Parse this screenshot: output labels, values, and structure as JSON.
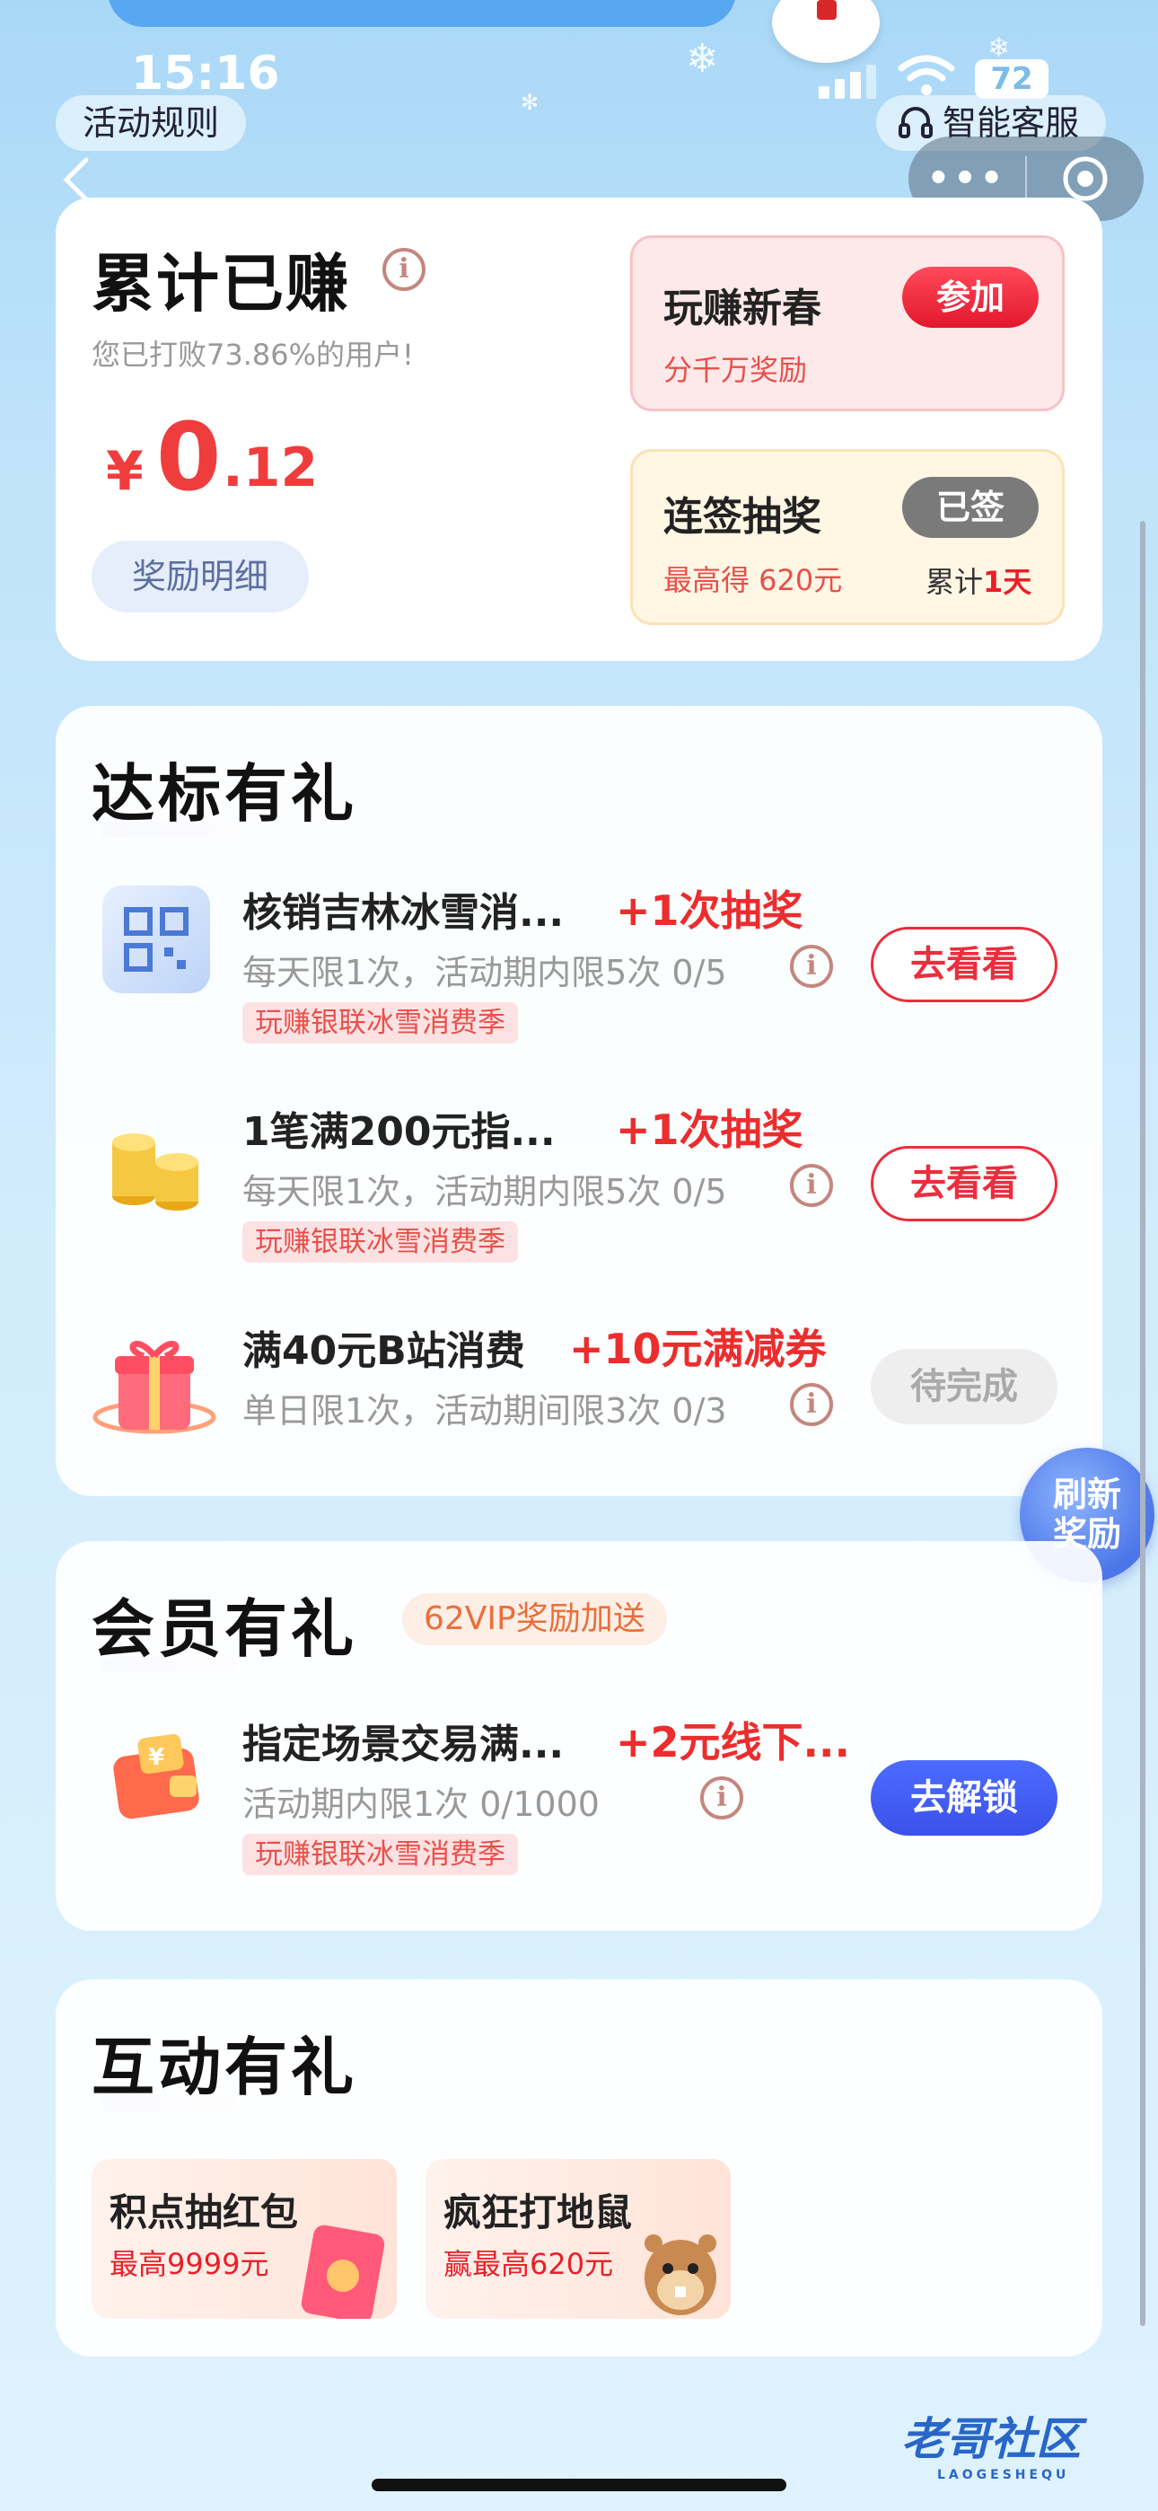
{
  "status_bar": {
    "time": "15:16",
    "battery": "72"
  },
  "header": {
    "rules_label": "活动规则",
    "service_label": "智能客服",
    "capsule_more": "•••"
  },
  "earnings": {
    "title": "累计已赚",
    "subtitle": "您已打败73.86%的用户!",
    "currency": "¥",
    "amount_integer": "0",
    "amount_decimal": ".12",
    "detail_button": "奖励明细",
    "promo_new_year": {
      "title": "玩赚新春",
      "subtitle": "分千万奖励",
      "button": "参加"
    },
    "promo_checkin": {
      "title": "连签抽奖",
      "subtitle": "最高得 620元",
      "button": "已签",
      "cumulative_prefix": "累计",
      "cumulative_days": "1天"
    }
  },
  "tasks_section": {
    "title": "达标有礼",
    "items": [
      {
        "title": "核销吉林冰雪消...",
        "reward": "+1次抽奖",
        "limit": "每天限1次，活动期内限5次 0/5",
        "tag": "玩赚银联冰雪消费季",
        "button": "去看看",
        "icon": "qr-code-icon"
      },
      {
        "title": "1笔满200元指...",
        "reward": "+1次抽奖",
        "limit": "每天限1次，活动期内限5次 0/5",
        "tag": "玩赚银联冰雪消费季",
        "button": "去看看",
        "icon": "gold-coins-icon"
      },
      {
        "title": "满40元B站消费",
        "reward": "+10元满减券",
        "limit": "单日限1次，活动期间限3次 0/3",
        "button": "待完成",
        "icon": "gift-box-icon"
      }
    ]
  },
  "refresh_bubble": {
    "line1": "刷新",
    "line2": "奖励"
  },
  "vip_section": {
    "title": "会员有礼",
    "badge": "62VIP奖励加送",
    "item": {
      "title": "指定场景交易满...",
      "reward": "+2元线下...",
      "limit": "活动期内限1次 0/1000",
      "tag": "玩赚银联冰雪消费季",
      "button": "去解锁",
      "icon": "wallet-icon"
    }
  },
  "interact_section": {
    "title": "互动有礼",
    "cards": [
      {
        "title": "积点抽红包",
        "subtitle": "最高9999元",
        "icon": "red-envelope-icon"
      },
      {
        "title": "疯狂打地鼠",
        "subtitle": "赢最高620元",
        "icon": "hamster-icon"
      }
    ]
  },
  "watermark": {
    "text": "老哥社区",
    "sub": "LAOGESHEQU"
  },
  "colors": {
    "accent_red": "#ec2d2d",
    "accent_blue": "#3a52e8",
    "background": "#bfe3fa"
  }
}
